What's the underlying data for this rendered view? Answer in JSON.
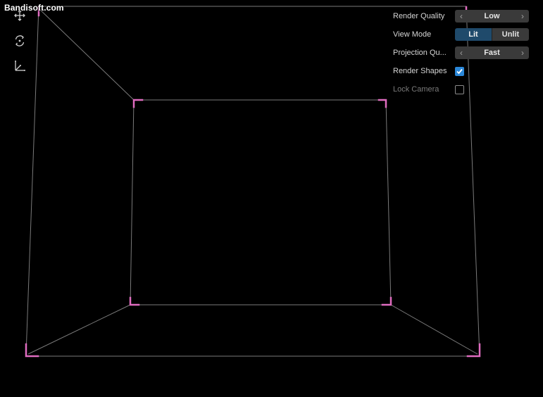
{
  "watermark": "Bandisoft.com",
  "toolbar": {
    "tools": [
      {
        "name": "move-tool",
        "icon": "move-arrows-icon"
      },
      {
        "name": "rotate-tool",
        "icon": "rotate-icon"
      },
      {
        "name": "axis-tool",
        "icon": "axis-icon"
      }
    ]
  },
  "panel": {
    "render_quality": {
      "label": "Render Quality",
      "value": "Low",
      "prev": "‹",
      "next": "›"
    },
    "view_mode": {
      "label": "View Mode",
      "options": [
        "Lit",
        "Unlit"
      ],
      "selected": "Lit"
    },
    "projection_quality": {
      "label": "Projection Qu...",
      "value": "Fast",
      "prev": "‹",
      "next": "›"
    },
    "render_shapes": {
      "label": "Render Shapes",
      "checked": true
    },
    "lock_camera": {
      "label": "Lock Camera",
      "checked": false,
      "enabled": false
    }
  },
  "colors": {
    "background": "#000000",
    "wire": "#7a7a7a",
    "corner_marker": "#e06cc0",
    "accent": "#2a87d8",
    "toggle_active": "#1f4a6b"
  }
}
